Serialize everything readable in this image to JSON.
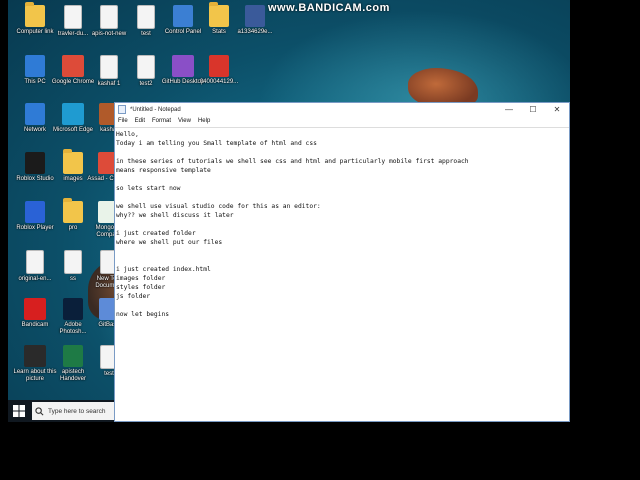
{
  "watermark": "www.BANDICAM.com",
  "desktop_icons": [
    {
      "label": "Computer link",
      "icon": "folder-icon",
      "kind": "folder"
    },
    {
      "label": "travler-du...",
      "icon": "document-icon",
      "kind": "file"
    },
    {
      "label": "apis-not-new",
      "icon": "document-icon",
      "kind": "file"
    },
    {
      "label": "test",
      "icon": "document-icon",
      "kind": "file"
    },
    {
      "label": "Control Panel",
      "icon": "control-panel-icon",
      "kind": "sq",
      "color": "#3b7fd3"
    },
    {
      "label": "Stats",
      "icon": "folder-icon",
      "kind": "folder"
    },
    {
      "label": "a1334629e...",
      "icon": "image-file-icon",
      "kind": "sq",
      "color": "#3a5a9a"
    },
    {
      "label": "This PC",
      "icon": "this-pc-icon",
      "kind": "sq",
      "color": "#2f7bd6"
    },
    {
      "label": "Google Chrome",
      "icon": "chrome-icon",
      "kind": "round",
      "color": "#dd4b39"
    },
    {
      "label": "kashaf 1",
      "icon": "image-file-icon",
      "kind": "file"
    },
    {
      "label": "test2",
      "icon": "script-file-icon",
      "kind": "file"
    },
    {
      "label": "GitHub Desktop",
      "icon": "github-desktop-icon",
      "kind": "round",
      "color": "#8a4fc7"
    },
    {
      "label": "0400044129...",
      "icon": "pdf-icon",
      "kind": "sq",
      "color": "#d9352b"
    },
    {
      "label": "Network",
      "icon": "network-icon",
      "kind": "sq",
      "color": "#2f7bd6"
    },
    {
      "label": "Microsoft Edge",
      "icon": "edge-icon",
      "kind": "round",
      "color": "#1f9bd1"
    },
    {
      "label": "kashaf",
      "icon": "image-file-icon",
      "kind": "sq",
      "color": "#b05a2a"
    },
    {
      "label": "Roblox Studio",
      "icon": "roblox-studio-icon",
      "kind": "sq",
      "color": "#1b1b1b"
    },
    {
      "label": "images",
      "icon": "folder-icon",
      "kind": "folder"
    },
    {
      "label": "Assad - Chrome",
      "icon": "chrome-icon",
      "kind": "round",
      "color": "#dd4b39"
    },
    {
      "label": "Roblox Player",
      "icon": "roblox-player-icon",
      "kind": "sq",
      "color": "#2a62d6"
    },
    {
      "label": "pro",
      "icon": "folder-icon",
      "kind": "folder"
    },
    {
      "label": "MongoDB Compass",
      "icon": "mongodb-icon",
      "kind": "round",
      "color": "#e9f3e9"
    },
    {
      "label": "original-en...",
      "icon": "document-icon",
      "kind": "file"
    },
    {
      "label": "ss",
      "icon": "document-icon",
      "kind": "file"
    },
    {
      "label": "New Text Document",
      "icon": "text-file-icon",
      "kind": "file"
    },
    {
      "label": "Bandicam",
      "icon": "bandicam-icon",
      "kind": "round",
      "color": "#d71f1f"
    },
    {
      "label": "Adobe Photosh...",
      "icon": "photoshop-icon",
      "kind": "sq",
      "color": "#0a1f3a"
    },
    {
      "label": "GitBash",
      "icon": "gitbash-icon",
      "kind": "sq",
      "color": "#5d8bd8"
    },
    {
      "label": "Learn about this picture",
      "icon": "camera-icon",
      "kind": "round",
      "color": "#2a2a2a"
    },
    {
      "label": "apistech Handover",
      "icon": "excel-icon",
      "kind": "sq",
      "color": "#1e7a45"
    },
    {
      "label": "test",
      "icon": "script-file-icon",
      "kind": "file"
    }
  ],
  "taskbar": {
    "search_placeholder": "Type here to search"
  },
  "notepad": {
    "title": "*Untitled - Notepad",
    "menu": [
      "File",
      "Edit",
      "Format",
      "View",
      "Help"
    ],
    "controls": {
      "minimize": "—",
      "maximize": "☐",
      "close": "✕"
    },
    "content": "Hello,\nToday i am telling you Small template of html and css\n\nin these series of tutorials we shell see css and html and particularly mobile first approach\nmeans responsive template\n\nso lets start now\n\nwe shell use visual studio code for this as an editor:\nwhy?? we shell discuss it later\n\ni just created folder\nwhere we shell put our files\n\n\ni just created index.html\nimages folder\nstyles folder\njs folder\n\nnow let begins"
  }
}
